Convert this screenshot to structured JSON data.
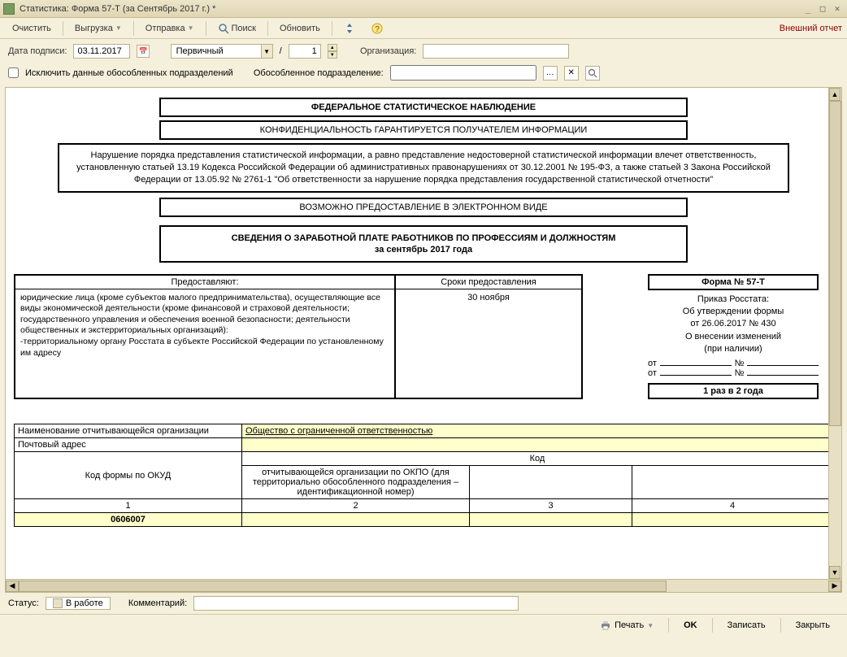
{
  "window": {
    "title": "Статистика: Форма 57-Т (за Сентябрь 2017 г.) *"
  },
  "toolbar": {
    "clear": "Очистить",
    "export": "Выгрузка",
    "send": "Отправка",
    "search": "Поиск",
    "refresh": "Обновить",
    "ext_report": "Внешний отчет"
  },
  "filter": {
    "date_label": "Дата подписи:",
    "date_value": "03.11.2017",
    "type_value": "Первичный",
    "slash": "/",
    "seq_value": "1",
    "org_label": "Организация:",
    "org_value": "",
    "exclude_label": "Исключить данные обособленных подразделений",
    "subdiv_label": "Обособленное подразделение:",
    "subdiv_value": ""
  },
  "doc": {
    "h1": "ФЕДЕРАЛЬНОЕ СТАТИСТИЧЕСКОЕ НАБЛЮДЕНИЕ",
    "h2": "КОНФИДЕНЦИАЛЬНОСТЬ ГАРАНТИРУЕТСЯ ПОЛУЧАТЕЛЕМ ИНФОРМАЦИИ",
    "h3": "Нарушение порядка представления статистической информации, а равно представление недостоверной статистической информации влечет ответственность, установленную статьей 13.19 Кодекса Российской Федерации об административных правонарушениях от 30.12.2001 № 195-ФЗ, а также статьей 3 Закона Российской Федерации от 13.05.92 № 2761-1 \"Об ответственности за нарушение порядка представления государственной статистической отчетности\"",
    "h4": "ВОЗМОЖНО ПРЕДОСТАВЛЕНИЕ В ЭЛЕКТРОННОМ ВИДЕ",
    "h5a": "СВЕДЕНИЯ О ЗАРАБОТНОЙ ПЛАТЕ РАБОТНИКОВ ПО ПРОФЕССИЯМ И ДОЛЖНОСТЯМ",
    "h5b": "за сентябрь 2017 года",
    "provide_h": "Предоставляют:",
    "provide_b": "юридические лица (кроме субъектов малого предпринимательства), осуществляющие все виды экономической деятельности (кроме финансовой и страховой деятельности; государственного управления и обеспечения военной безопасности; деятельности общественных и экстерриториальных организаций):\n   -территориальному органу Росстата в субъекте Российской Федерации по установленному им адресу",
    "deadline_h": "Сроки предоставления",
    "deadline_b": "30 ноября",
    "form_no": "Форма № 57-Т",
    "order1": "Приказ Росстата:",
    "order2": "Об утверждении формы",
    "order3": "от 26.06.2017 № 430",
    "order4": "О внесении изменений",
    "order5": "(при наличии)",
    "ot": "от",
    "no": "№",
    "freq": "1 раз в 2 года",
    "org_name_label": "Наименование отчитывающейся организации",
    "org_name_value": "Общество с ограниченной ответственностью",
    "postal_label": "Почтовый адрес",
    "code_label": "Код",
    "okud_label": "Код формы по ОКУД",
    "okpo_label": "отчитывающейся организации по ОКПО (для территориально обособленного подразделения – идентификационной номер)",
    "col1": "1",
    "col2": "2",
    "col3": "3",
    "col4": "4",
    "okud_value": "0606007"
  },
  "status": {
    "label": "Статус:",
    "value": "В работе",
    "comment_label": "Комментарий:"
  },
  "footer": {
    "print": "Печать",
    "ok": "OK",
    "save": "Записать",
    "close": "Закрыть"
  }
}
